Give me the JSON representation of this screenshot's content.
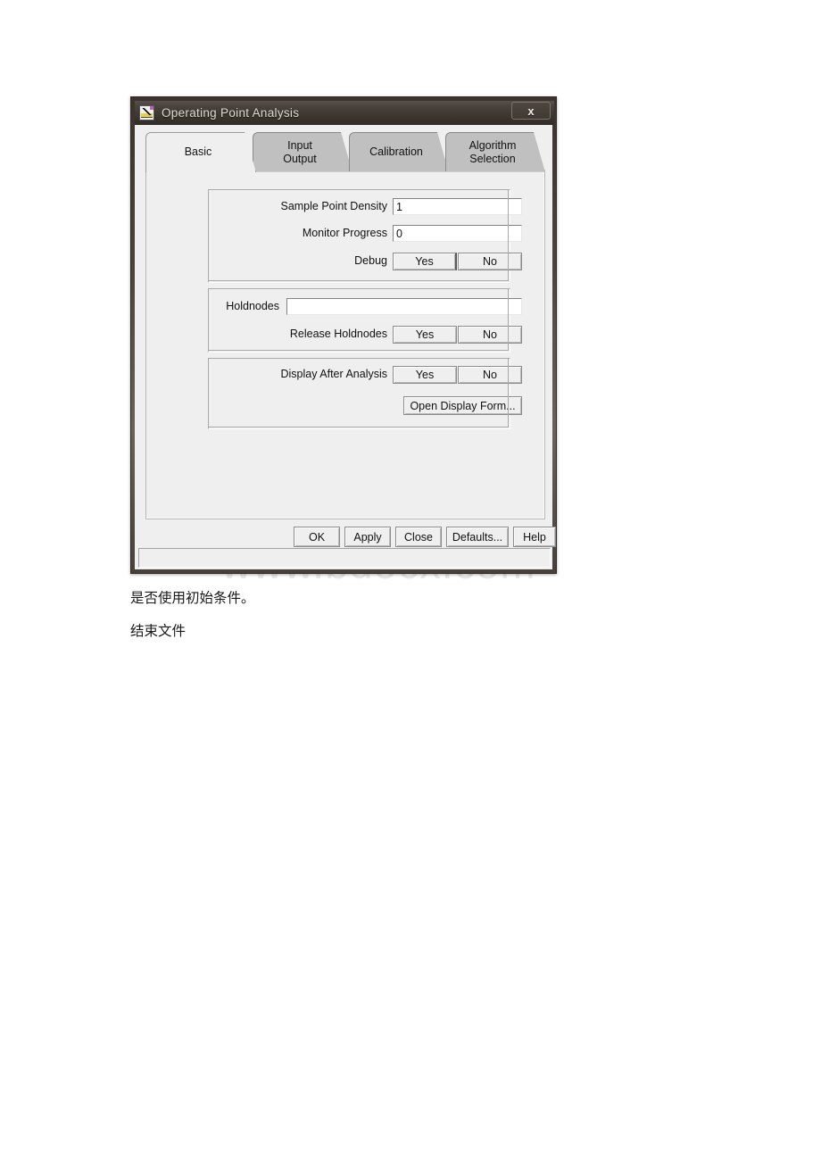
{
  "page": {
    "watermark": "www.bdocx.com",
    "body_lines": [
      "是否使用初始条件。",
      "结束文件"
    ]
  },
  "dialog": {
    "title": "Operating Point Analysis",
    "icon": "waveform-chart-icon",
    "close_label": "x",
    "tabs": [
      {
        "label": "Basic",
        "active": true
      },
      {
        "label": "Input\nOutput",
        "active": false
      },
      {
        "label": "Calibration",
        "active": false
      },
      {
        "label": "Algorithm\nSelection",
        "active": false
      }
    ],
    "groups": {
      "simulation": {
        "sample_point_density": {
          "label": "Sample Point Density",
          "value": "1",
          "placeholder": ""
        },
        "monitor_progress": {
          "label": "Monitor Progress",
          "value": "0",
          "placeholder": ""
        },
        "debug": {
          "label": "Debug",
          "yes": "Yes",
          "no": "No",
          "selected": "No"
        }
      },
      "holdnodes": {
        "holdnodes": {
          "label": "Holdnodes",
          "value": "",
          "placeholder": ""
        },
        "release_holdnodes": {
          "label": "Release Holdnodes",
          "yes": "Yes",
          "no": "No",
          "selected": "No"
        }
      },
      "display": {
        "display_after_analysis": {
          "label": "Display After Analysis",
          "yes": "Yes",
          "no": "No",
          "selected": "No"
        },
        "open_display_form": "Open Display Form..."
      }
    },
    "buttons": {
      "ok": "OK",
      "apply": "Apply",
      "close": "Close",
      "defaults": "Defaults...",
      "help": "Help"
    },
    "statusbar": ""
  },
  "colors": {
    "titlebar_dark": "#312c28",
    "titlebar_light": "#58504a",
    "dialog_face": "#efefef",
    "tab_inactive": "#c0c0c0",
    "field_bg": "#ffffff",
    "border": "#8c8c8c",
    "watermark": "#e9e6e6"
  }
}
